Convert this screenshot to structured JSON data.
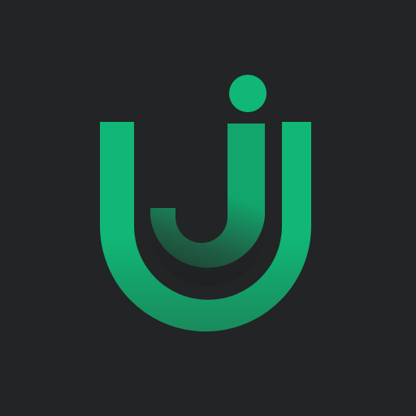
{
  "colors": {
    "background": "#222425",
    "brand_green": "#10b776",
    "brand_green_mid": "#13a86c",
    "brand_green_dark": "#1c6a4a"
  },
  "logo": {
    "icon": "uj-monogram-icon"
  }
}
